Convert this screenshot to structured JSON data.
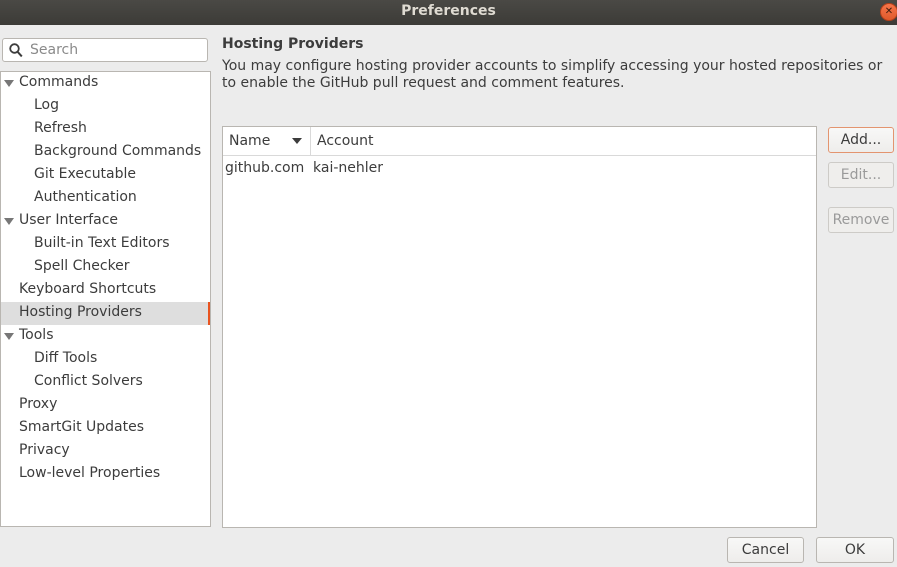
{
  "window": {
    "title": "Preferences"
  },
  "search": {
    "placeholder": "Search"
  },
  "sidebar": {
    "items": [
      {
        "label": "Commands",
        "level": 0,
        "expanded": true
      },
      {
        "label": "Log",
        "level": 1
      },
      {
        "label": "Refresh",
        "level": 1
      },
      {
        "label": "Background Commands",
        "level": 1
      },
      {
        "label": "Git Executable",
        "level": 1
      },
      {
        "label": "Authentication",
        "level": 1
      },
      {
        "label": "User Interface",
        "level": 0,
        "expanded": true
      },
      {
        "label": "Built-in Text Editors",
        "level": 1
      },
      {
        "label": "Spell Checker",
        "level": 1
      },
      {
        "label": "Keyboard Shortcuts",
        "level": 0
      },
      {
        "label": "Hosting Providers",
        "level": 0,
        "selected": true
      },
      {
        "label": "Tools",
        "level": 0,
        "expanded": true
      },
      {
        "label": "Diff Tools",
        "level": 1
      },
      {
        "label": "Conflict Solvers",
        "level": 1
      },
      {
        "label": "Proxy",
        "level": 0
      },
      {
        "label": "SmartGit Updates",
        "level": 0
      },
      {
        "label": "Privacy",
        "level": 0
      },
      {
        "label": "Low-level Properties",
        "level": 0
      }
    ]
  },
  "main": {
    "title": "Hosting Providers",
    "description": "You may configure hosting provider accounts to simplify accessing your hosted repositories or to enable the GitHub pull request and comment features.",
    "table": {
      "columns": [
        "Name",
        "Account"
      ],
      "rows": [
        {
          "name": "github.com",
          "account": "kai-nehler"
        }
      ]
    },
    "buttons": {
      "add": "Add...",
      "edit": "Edit...",
      "remove": "Remove"
    }
  },
  "footer": {
    "cancel": "Cancel",
    "ok": "OK"
  },
  "colors": {
    "accent": "#e95420",
    "titlebar": "#3c3b37"
  }
}
